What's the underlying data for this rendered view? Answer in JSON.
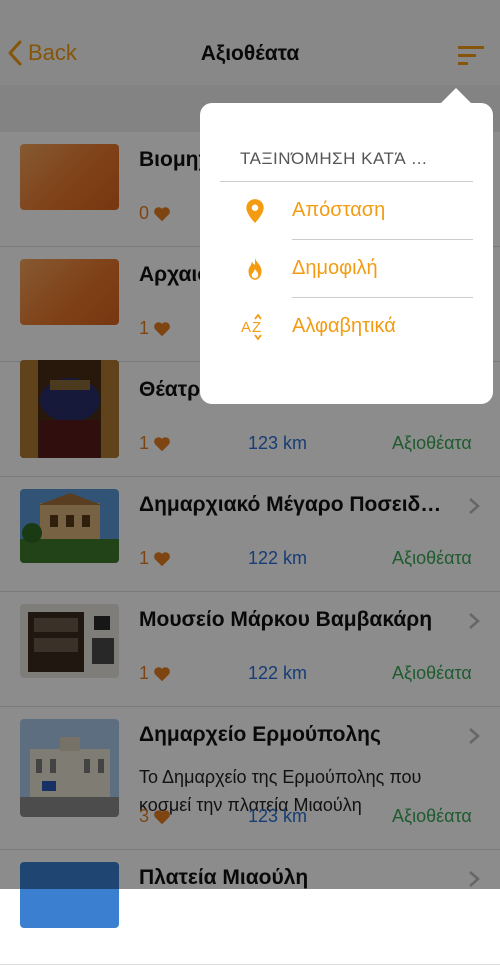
{
  "nav": {
    "back_label": "Back",
    "title": "Αξιοθέατα"
  },
  "colors": {
    "accent": "#f39c12",
    "distance": "#2a6fd6",
    "category": "#3aa657"
  },
  "places": [
    {
      "name": "Βιομηχανικό Μουσείο Ερμούπολης",
      "likes": "0",
      "distance": "",
      "category": "",
      "thumb": "orange"
    },
    {
      "name": "Αρχαιολογικό Μουσείο Ερμούπολης",
      "likes": "1",
      "distance": "",
      "category": "",
      "thumb": "orange"
    },
    {
      "name": "Θέατρο Απόλλων",
      "likes": "1",
      "distance": "123 km",
      "category": "Αξιοθέατα",
      "thumb": "theatre"
    },
    {
      "name": "Δημαρχιακό Μέγαρο Ποσειδωνίας",
      "likes": "1",
      "distance": "122 km",
      "category": "Αξιοθέατα",
      "thumb": "building"
    },
    {
      "name": "Μουσείο Μάρκου Βαμβακάρη",
      "likes": "1",
      "distance": "122 km",
      "category": "Αξιοθέατα",
      "thumb": "museum"
    },
    {
      "name": "Δημαρχείο Ερμούπολης",
      "description": "Το Δημαρχείο της Ερμούπολης που κοσμεί την πλατεία Μιαούλη",
      "likes": "3",
      "distance": "123 km",
      "category": "Αξιοθέατα",
      "thumb": "townhall"
    },
    {
      "name": "Πλατεία Μιαούλη",
      "likes": "",
      "distance": "",
      "category": "",
      "thumb": "sky"
    }
  ],
  "sort_menu": {
    "title": "ΤΑΞΙΝΌΜΗΣΗ ΚΑΤΆ ...",
    "options": [
      {
        "label": "Απόσταση",
        "icon": "location-pin-icon"
      },
      {
        "label": "Δημοφιλή",
        "icon": "flame-icon"
      },
      {
        "label": "Αλφαβητικά",
        "icon": "alphabetical-sort-icon"
      }
    ]
  }
}
